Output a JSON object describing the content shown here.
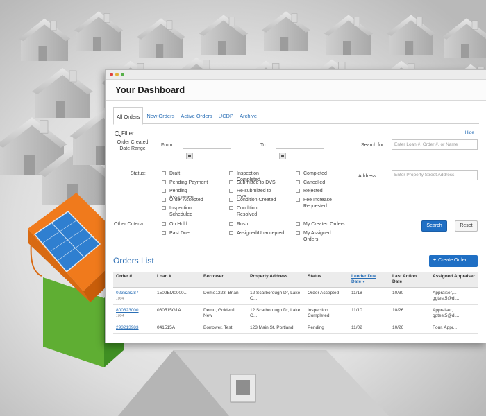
{
  "colors": {
    "accent": "#1f6fc4",
    "link": "#2a6fb6",
    "house_orange": "#f07a1c",
    "house_green": "#6cbf3c",
    "solar_blue": "#2f7fd0"
  },
  "dashboard": {
    "title": "Your Dashboard"
  },
  "tabs": [
    "All Orders",
    "New Orders",
    "Active Orders",
    "UCDP",
    "Archive"
  ],
  "filter": {
    "label": "Filter",
    "hide_label": "Hide",
    "order_created_label": "Order Created\nDate Range",
    "from_label": "From:",
    "to_label": "To:",
    "search_for_label": "Search for:",
    "search_placeholder": "Enter Loan #, Order #, or Name",
    "address_label": "Address:",
    "address_placeholder": "Enter Property Street Address",
    "status_label": "Status:",
    "status_col1": [
      "Draft",
      "Pending Payment",
      "Pending Assignment",
      "Order Accepted",
      "Inspection Scheduled"
    ],
    "status_col2": [
      "Inspection Completed",
      "Submitted to DVS",
      "Re-submitted to DVS",
      "Condition Created",
      "Condition Resolved"
    ],
    "status_col3": [
      "Completed",
      "Cancelled",
      "Rejected",
      "Fee Increase Requested"
    ],
    "other_label": "Other Criteria:",
    "other_col1": [
      "On Hold",
      "Past Due"
    ],
    "other_col2": [
      "Rush",
      "Assigned/Unaccepted"
    ],
    "other_col3": [
      "My Created Orders",
      "My Assigned Orders"
    ],
    "search_button": "Search",
    "reset_button": "Reset"
  },
  "orders": {
    "title": "Orders List",
    "create_button": "Create Order",
    "columns": [
      "Order #",
      "Loan #",
      "Borrower",
      "Property Address",
      "Status",
      "Lender Due Date",
      "Last Action Date",
      "Assigned Appraiser"
    ],
    "rows": [
      {
        "order": "023628287",
        "order_sub": "1004",
        "loan": "1509EM0000...",
        "borrower": "Demo1223, Brian",
        "address": "12 Scarborough Dr, Lake O...",
        "status": "Order Accepted",
        "due": "11/18",
        "last": "10/30",
        "appraiser": "Appraiser,... ggtest5@di..."
      },
      {
        "order": "800323000",
        "order_sub": "1004",
        "loan": "060515G1A",
        "borrower": "Demo, Golden1 New",
        "address": "12 Scarborough Dr, Lake O...",
        "status": "Inspection Completed",
        "due": "11/10",
        "last": "10/26",
        "appraiser": "Appraiser,... ggtest5@di..."
      },
      {
        "order": "293213983",
        "order_sub": "",
        "loan": "041515A",
        "borrower": "Borrower, Test",
        "address": "123 Main St, Portland,",
        "status": "Pending",
        "due": "11/02",
        "last": "10/26",
        "appraiser": "Four, Appr..."
      }
    ]
  }
}
